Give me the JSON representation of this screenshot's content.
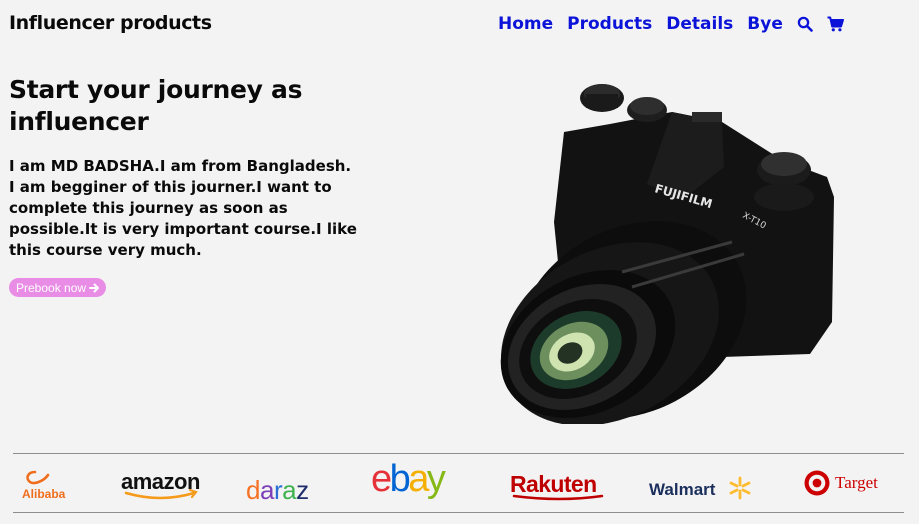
{
  "header": {
    "brand": "Influencer products",
    "nav": [
      "Home",
      "Products",
      "Details",
      "Bye"
    ],
    "icons": [
      "search-icon",
      "cart-icon"
    ]
  },
  "hero": {
    "title": "Start your journey as influencer",
    "description": "I am MD BADSHA.I am from Bangladesh. I am begginer of this journer.I want to complete this journey as soon as possible.It is very important course.I like this course very much.",
    "button_label": "Prebook now",
    "image": "camera-image",
    "camera_brand": "FUJIFILM",
    "camera_model": "X-T10"
  },
  "partners": {
    "logos": [
      "Alibaba",
      "amazon",
      "daraz",
      "ebay",
      "Rakuten",
      "Walmart",
      "Target"
    ]
  },
  "colors": {
    "nav": "#0b13d8",
    "button": "#e98ce6",
    "background": "#f4f3f4"
  }
}
